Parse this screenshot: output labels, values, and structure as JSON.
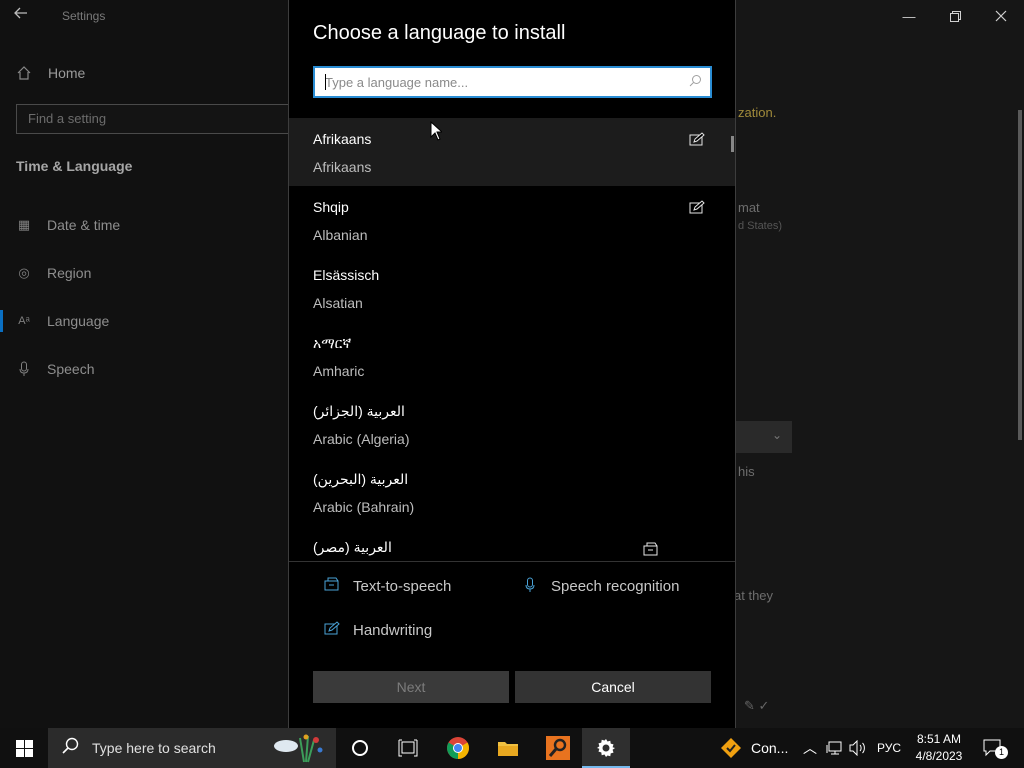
{
  "settings": {
    "app_title": "Settings",
    "home_label": "Home",
    "find_placeholder": "Find a setting",
    "section_title": "Time & Language",
    "nav_items": [
      {
        "label": "Date & time",
        "icon": "calendar-clock-icon"
      },
      {
        "label": "Region",
        "icon": "globe-icon"
      },
      {
        "label": "Language",
        "icon": "language-icon"
      },
      {
        "label": "Speech",
        "icon": "microphone-icon"
      }
    ],
    "background_fragments": [
      "zation.",
      "mat",
      "d States)",
      "his",
      "at they"
    ]
  },
  "dialog": {
    "title": "Choose a language to install",
    "search_placeholder": "Type a language name...",
    "languages": [
      {
        "native": "Afrikaans",
        "english": "Afrikaans",
        "feature_icon": "handwriting-icon"
      },
      {
        "native": "Shqip",
        "english": "Albanian",
        "feature_icon": "handwriting-icon"
      },
      {
        "native": "Elsässisch",
        "english": "Alsatian",
        "feature_icon": ""
      },
      {
        "native": "አማርኛ",
        "english": "Amharic",
        "feature_icon": ""
      },
      {
        "native": "العربية (الجزائر)",
        "english": "Arabic (Algeria)",
        "feature_icon": ""
      },
      {
        "native": "العربية (البحرين)",
        "english": "Arabic (Bahrain)",
        "feature_icon": ""
      },
      {
        "native": "العربية (مصر)",
        "english": "",
        "feature_icon": "text-to-speech-icon"
      }
    ],
    "legend": {
      "tts": "Text-to-speech",
      "speech": "Speech recognition",
      "handwriting": "Handwriting"
    },
    "next_label": "Next",
    "cancel_label": "Cancel"
  },
  "taskbar": {
    "search_text": "Type here to search",
    "tray_app_label": "Con...",
    "input_language": "РУС",
    "time": "8:51 AM",
    "date": "4/8/2023",
    "notification_count": "1"
  },
  "colors": {
    "accent": "#2a8dd4",
    "legend_icon": "#4aa3d8",
    "dialog_bg": "#000000"
  }
}
